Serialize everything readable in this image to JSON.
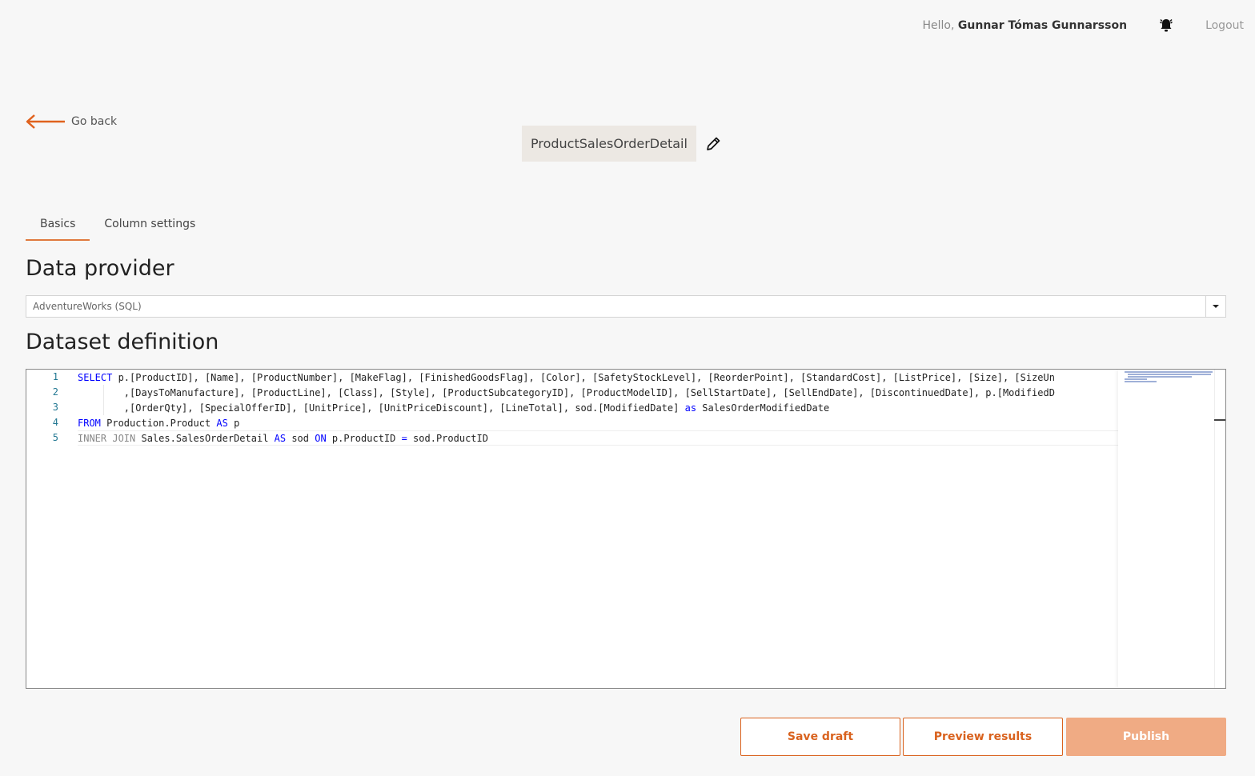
{
  "header": {
    "greeting_prefix": "Hello,",
    "user_name": "Gunnar Tómas Gunnarsson",
    "logout_label": "Logout",
    "bell_icon": "bell-icon"
  },
  "nav": {
    "go_back_label": "Go back",
    "accent_color": "#e07a3d"
  },
  "dataset": {
    "name": "ProductSalesOrderDetail"
  },
  "tabs": [
    {
      "label": "Basics",
      "active": true
    },
    {
      "label": "Column settings",
      "active": false
    }
  ],
  "data_provider": {
    "heading": "Data provider",
    "selected": "AdventureWorks (SQL)"
  },
  "dataset_definition": {
    "heading": "Dataset definition",
    "line_numbers": [
      "1",
      "2",
      "3",
      "4",
      "5"
    ],
    "lines": [
      [
        [
          "kw",
          "SELECT"
        ],
        [
          "",
          " p.[ProductID], [Name], [ProductNumber], [MakeFlag], [FinishedGoodsFlag], [Color], [SafetyStockLevel], [ReorderPoint], [StandardCost], [ListPrice], [Size], [SizeUn"
        ]
      ],
      [
        [
          "",
          "        ,[DaysToManufacture], [ProductLine], [Class], [Style], [ProductSubcategoryID], [ProductModelID], [SellStartDate], [SellEndDate], [DiscontinuedDate], p.[ModifiedD"
        ]
      ],
      [
        [
          "",
          "        ,[OrderQty], [SpecialOfferID], [UnitPrice], [UnitPriceDiscount], [LineTotal], sod.[ModifiedDate] "
        ],
        [
          "kw",
          "as"
        ],
        [
          "",
          " SalesOrderModifiedDate"
        ]
      ],
      [
        [
          "kw",
          "FROM"
        ],
        [
          "",
          " Production.Product "
        ],
        [
          "kw",
          "AS"
        ],
        [
          "",
          " p"
        ]
      ],
      [
        [
          "kwg",
          "INNER JOIN"
        ],
        [
          "",
          " Sales.SalesOrderDetail "
        ],
        [
          "kw",
          "AS"
        ],
        [
          "",
          " sod "
        ],
        [
          "kw",
          "ON"
        ],
        [
          "",
          " p.ProductID "
        ],
        [
          "kw",
          "="
        ],
        [
          "",
          " sod.ProductID"
        ]
      ]
    ]
  },
  "actions": {
    "save_draft": "Save draft",
    "preview_results": "Preview results",
    "publish": "Publish"
  }
}
